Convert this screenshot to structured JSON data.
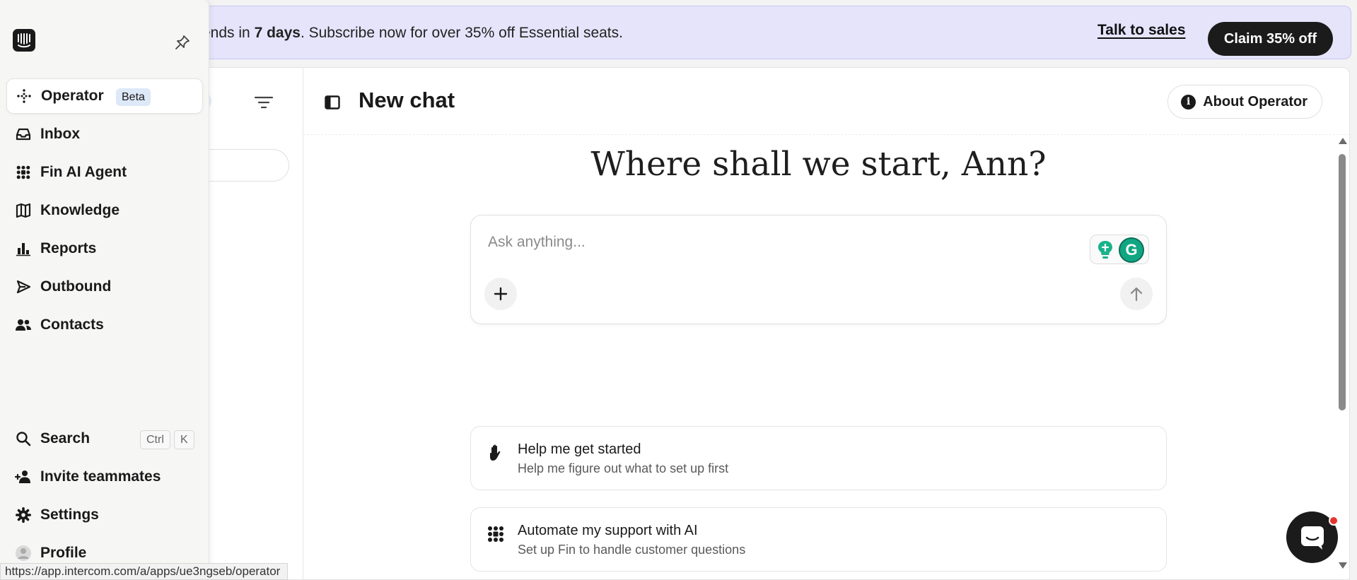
{
  "banner": {
    "prefix": "ends in ",
    "days": "7 days",
    "suffix": ". Subscribe now for over 35% off Essential seats.",
    "talk_label": "Talk to sales",
    "claim_label": "Claim 35% off",
    "background": "#e6e4fb"
  },
  "sidebar": {
    "items": [
      {
        "label": "Operator",
        "badge": "Beta",
        "icon": "operator-icon",
        "active": true
      },
      {
        "label": "Inbox",
        "icon": "inbox-icon"
      },
      {
        "label": "Fin AI Agent",
        "icon": "fin-icon"
      },
      {
        "label": "Knowledge",
        "icon": "book-icon"
      },
      {
        "label": "Reports",
        "icon": "bar-chart-icon"
      },
      {
        "label": "Outbound",
        "icon": "send-icon"
      },
      {
        "label": "Contacts",
        "icon": "people-icon"
      }
    ],
    "bottom": [
      {
        "label": "Search",
        "icon": "search-icon",
        "shortcut": [
          "Ctrl",
          "K"
        ]
      },
      {
        "label": "Invite teammates",
        "icon": "add-person-icon"
      },
      {
        "label": "Settings",
        "icon": "gear-icon"
      },
      {
        "label": "Profile",
        "icon": "avatar-icon"
      }
    ]
  },
  "chat": {
    "title": "New chat",
    "about_label": "About Operator",
    "greeting": "Where shall we start, Ann?",
    "input_placeholder": "Ask anything...",
    "suggestions": [
      {
        "title": "Help me get started",
        "subtitle": "Help me figure out what to set up first",
        "icon": "hand-icon"
      },
      {
        "title": "Automate my support with AI",
        "subtitle": "Set up Fin to handle customer questions",
        "icon": "fin-icon"
      }
    ]
  },
  "status_bar": {
    "url": "https://app.intercom.com/a/apps/ue3ngseb/operator"
  },
  "colors": {
    "accent_dark": "#1b1b1b",
    "beta_badge": "#dde8f8",
    "notification": "#e5342c",
    "grammarly": "#11a683"
  }
}
